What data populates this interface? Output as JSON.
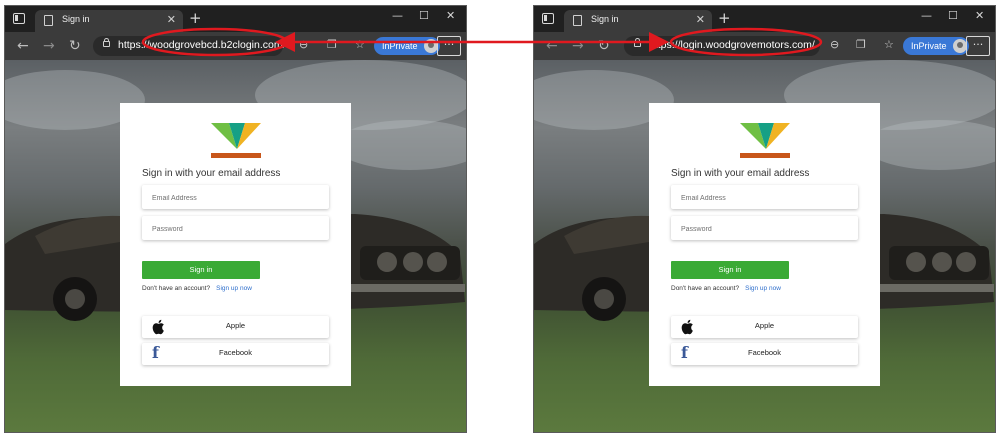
{
  "browser": {
    "tab_title": "Sign in",
    "close_glyph": "✕",
    "newtab_glyph": "+",
    "minimize_glyph": "—",
    "maximize_glyph": "☐",
    "winclose_glyph": "✕",
    "back_glyph": "←",
    "forward_glyph": "→",
    "refresh_glyph": "↻",
    "url_scheme": "https://",
    "inprivate_label": "InPrivate",
    "more_glyph": "···"
  },
  "windows": [
    {
      "url_host": "woodgrovebcd.b2clogin.com/"
    },
    {
      "url_host": "login.woodgrovemotors.com/"
    }
  ],
  "signin": {
    "heading": "Sign in with your email address",
    "email_placeholder": "Email Address",
    "password_placeholder": "Password",
    "signin_label": "Sign in",
    "no_account_text": "Don't have an account?",
    "signup_link": "Sign up now",
    "apple_label": "Apple",
    "facebook_label": "Facebook"
  },
  "colors": {
    "accent_green": "#3aaa35",
    "link_blue": "#2f6fcc",
    "inprivate_blue": "#3a78d6",
    "annotation_red": "#e0191f",
    "logo_green": "#6fbf44",
    "logo_yellow": "#f0b323",
    "logo_teal": "#16a085",
    "logo_bar": "#c8561a"
  },
  "icons": {
    "tab_page": "page-icon",
    "lock": "lock-icon",
    "apple": "apple-logo-icon",
    "facebook": "facebook-logo-icon",
    "favorites": "star-icon",
    "collections": "collections-icon",
    "zoom": "zoom-icon"
  }
}
